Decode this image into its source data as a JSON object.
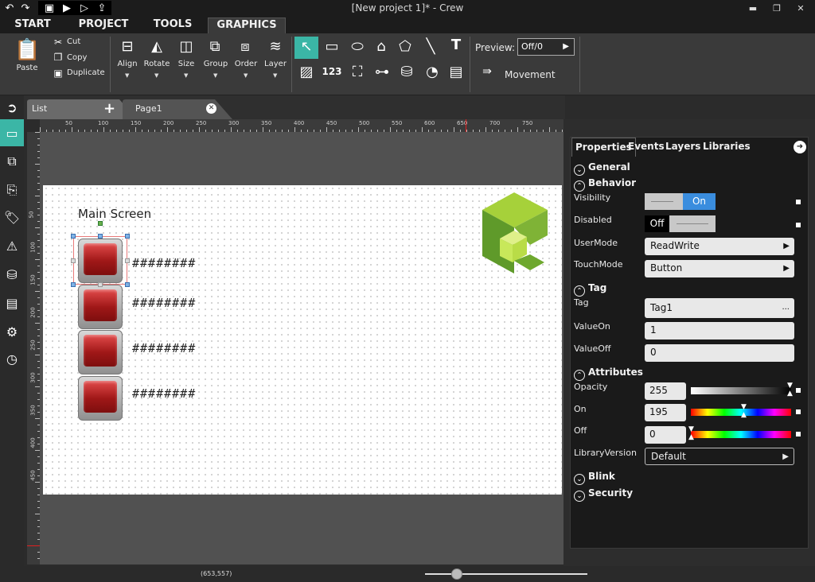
{
  "window": {
    "title": "[New project 1]* - Crew"
  },
  "menu_tabs": [
    "START",
    "PROJECT",
    "TOOLS",
    "GRAPHICS"
  ],
  "ribbon": {
    "clipboard": {
      "paste": "Paste",
      "cut": "Cut",
      "copy": "Copy",
      "duplicate": "Duplicate"
    },
    "arrange": [
      "Align",
      "Rotate",
      "Size",
      "Group",
      "Order",
      "Layer"
    ],
    "counter_label": "123",
    "preview_label": "Preview:",
    "preview_value": "Off/0",
    "movement_label": "Movement"
  },
  "doc_tabs": [
    "List",
    "Page1"
  ],
  "ruler": {
    "h_major": [
      "50",
      "100",
      "150",
      "200",
      "250",
      "300",
      "350",
      "400",
      "450",
      "500",
      "550",
      "600",
      "650",
      "700",
      "750"
    ],
    "v_major": [
      "50",
      "100",
      "150",
      "200",
      "250",
      "300",
      "350",
      "400",
      "450"
    ]
  },
  "canvas": {
    "title": "Main Screen",
    "rows": [
      "########",
      "########",
      "########",
      "########"
    ]
  },
  "props_tabs": [
    "Properties",
    "Events",
    "Layers",
    "Libraries"
  ],
  "props": {
    "general": "General",
    "behavior": "Behavior",
    "visibility_label": "Visibility",
    "visibility_value": "On",
    "disabled_label": "Disabled",
    "disabled_value": "Off",
    "usermode_label": "UserMode",
    "usermode_value": "ReadWrite",
    "touchmode_label": "TouchMode",
    "touchmode_value": "Button",
    "tag_section": "Tag",
    "tag_label": "Tag",
    "tag_value": "Tag1",
    "tag_more": "...",
    "valueon_label": "ValueOn",
    "valueon_value": "1",
    "valueoff_label": "ValueOff",
    "valueoff_value": "0",
    "attributes": "Attributes",
    "opacity_label": "Opacity",
    "opacity_value": "255",
    "on_label": "On",
    "on_value": "195",
    "off_label": "Off",
    "off_value": "0",
    "libver_label": "LibraryVersion",
    "libver_value": "Default",
    "blink": "Blink",
    "security": "Security"
  },
  "status": {
    "coords": "(653,557)"
  },
  "colors": {
    "accent": "#3bb6a6",
    "toggle_on": "#3a8dde",
    "button_red": "#b81f1f",
    "logo_green": "#8cc63f"
  }
}
